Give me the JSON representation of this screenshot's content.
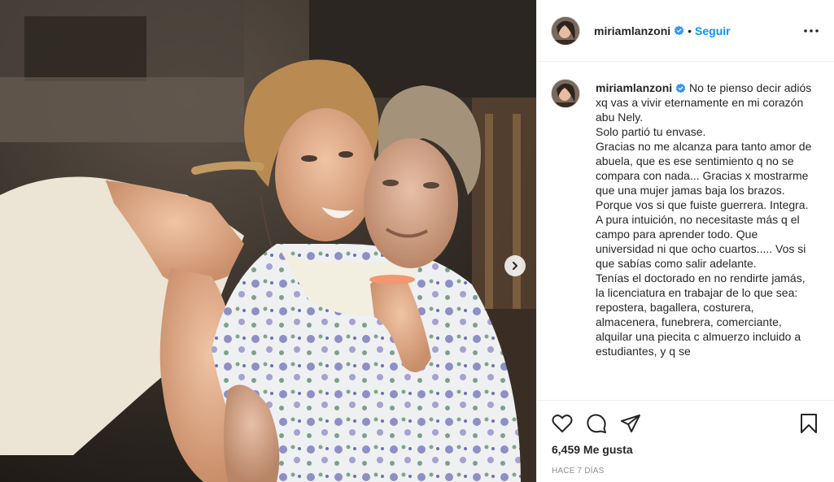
{
  "post": {
    "username": "miriamlanzoni",
    "follow_label": "Seguir",
    "separator": "•",
    "caption_lines": "No te pienso decir adiós xq vas a vivir eternamente en mi corazón abu Nely.\nSolo partió tu envase.\nGracias no me alcanza para tanto amor de abuela, que es ese sentimiento q no se compara con nada... Gracias x mostrarme que una mujer jamas baja los brazos. Porque vos si que fuiste guerrera. Integra.\nA pura intuición, no necesitaste más q el campo para aprender todo. Que universidad ni que ocho cuartos..... Vos si que sabías como salir adelante.\nTenías el doctorado en no rendirte jamás, la licenciatura en trabajar de lo que sea: repostera, bagallera, costurera, almacenera, funebrera, comerciante, alquilar una piecita c almuerzo incluido a estudiantes, y q se",
    "likes": "6,459 Me gusta",
    "time": "Hace 7 días"
  },
  "icons": {
    "verified": "verified-badge-icon",
    "more": "more-options-icon",
    "like": "heart-icon",
    "comment": "comment-icon",
    "share": "share-icon",
    "save": "bookmark-icon",
    "next": "chevron-right-icon"
  },
  "colors": {
    "accent": "#0095f6",
    "text": "#262626",
    "muted": "#8e8e8e",
    "border": "#efefef"
  }
}
